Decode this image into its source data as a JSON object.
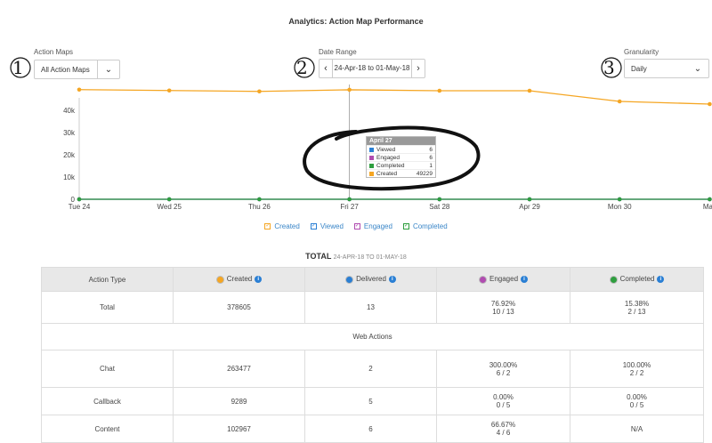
{
  "title": "Analytics: Action Map Performance",
  "controls": {
    "action_maps": {
      "label": "Action Maps",
      "value": "All Action Maps",
      "number": "1"
    },
    "date_range": {
      "label": "Date Range",
      "value": "24-Apr-18 to 01-May-18",
      "number": "2",
      "prev": "‹",
      "next": "›"
    },
    "granularity": {
      "label": "Granularity",
      "value": "Daily",
      "number": "3"
    }
  },
  "chart_data": {
    "type": "line",
    "categories": [
      "Tue 24",
      "Wed 25",
      "Thu 26",
      "Fri 27",
      "Sat 28",
      "Apr 29",
      "Mon 30",
      "May"
    ],
    "series": [
      {
        "name": "Created",
        "color": "#f5a623",
        "values": [
          49300,
          48900,
          48500,
          49229,
          48800,
          48800,
          44000,
          42800
        ]
      },
      {
        "name": "Viewed",
        "color": "#2a7fd4",
        "values": [
          0,
          0,
          0,
          0,
          0,
          0,
          0,
          0
        ]
      },
      {
        "name": "Engaged",
        "color": "#b04cb0",
        "values": [
          0,
          0,
          0,
          0,
          0,
          0,
          0,
          0
        ]
      },
      {
        "name": "Completed",
        "color": "#2e9e3e",
        "values": [
          0,
          0,
          0,
          0,
          0,
          0,
          0,
          0
        ]
      }
    ],
    "yticks": [
      "0",
      "10k",
      "20k",
      "30k",
      "40k"
    ],
    "ylim": [
      0,
      50000
    ],
    "grid": false,
    "legend": "bottom"
  },
  "tooltip": {
    "title": "April 27",
    "rows": [
      {
        "label": "Viewed",
        "value": "6",
        "color": "#2a7fd4"
      },
      {
        "label": "Engaged",
        "value": "6",
        "color": "#b04cb0"
      },
      {
        "label": "Completed",
        "value": "1",
        "color": "#2e9e3e"
      },
      {
        "label": "Created",
        "value": "49229",
        "color": "#f5a623"
      }
    ]
  },
  "legend": [
    {
      "label": "Created",
      "color": "#f5a623"
    },
    {
      "label": "Viewed",
      "color": "#2a7fd4"
    },
    {
      "label": "Engaged",
      "color": "#b04cb0"
    },
    {
      "label": "Completed",
      "color": "#2e9e3e"
    }
  ],
  "total": {
    "label": "TOTAL",
    "range": "24-APR-18 TO 01-MAY-18"
  },
  "table": {
    "headers": [
      {
        "label": "Action Type"
      },
      {
        "label": "Created",
        "dot": "#f5a623"
      },
      {
        "label": "Delivered",
        "dot": "#2a7fd4"
      },
      {
        "label": "Engaged",
        "dot": "#b04cb0"
      },
      {
        "label": "Completed",
        "dot": "#2e9e3e"
      }
    ],
    "info_glyph": "i",
    "rows": [
      {
        "type": "Total",
        "created": "378605",
        "delivered": "13",
        "engaged": [
          "76.92%",
          "10 / 13"
        ],
        "completed": [
          "15.38%",
          "2 / 13"
        ]
      },
      {
        "section": "Web Actions"
      },
      {
        "type": "Chat",
        "created": "263477",
        "delivered": "2",
        "engaged": [
          "300.00%",
          "6 / 2"
        ],
        "completed": [
          "100.00%",
          "2 / 2"
        ]
      },
      {
        "type": "Callback",
        "created": "9289",
        "delivered": "5",
        "engaged": [
          "0.00%",
          "0 / 5"
        ],
        "completed": [
          "0.00%",
          "0 / 5"
        ]
      },
      {
        "type": "Content",
        "created": "102967",
        "delivered": "6",
        "engaged": [
          "66.67%",
          "4 / 6"
        ],
        "completed": [
          "N/A"
        ]
      }
    ]
  }
}
